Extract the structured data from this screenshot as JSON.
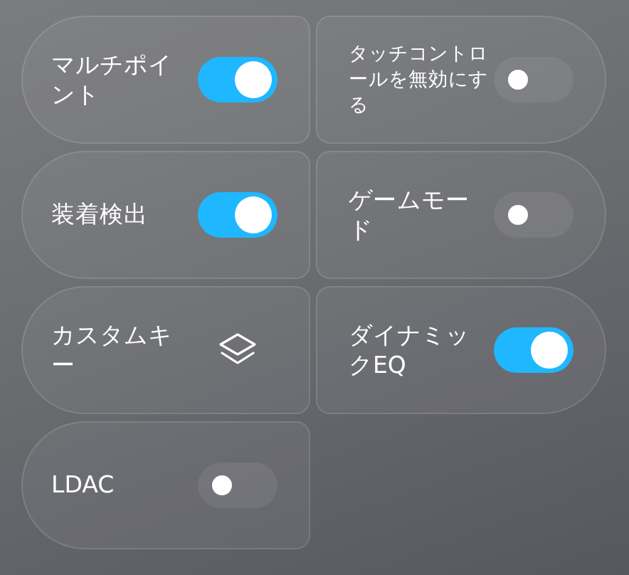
{
  "rows": [
    {
      "tiles": [
        {
          "label": "マルチポイント",
          "kind": "toggle",
          "on": true
        },
        {
          "label": "タッチコントロールを無効にする",
          "kind": "toggle",
          "on": false
        }
      ]
    },
    {
      "tiles": [
        {
          "label": "装着検出",
          "kind": "toggle",
          "on": true
        },
        {
          "label": "ゲームモード",
          "kind": "toggle",
          "on": false
        }
      ]
    },
    {
      "tiles": [
        {
          "label": "カスタムキー",
          "kind": "layers"
        },
        {
          "label": "ダイナミックEQ",
          "kind": "toggle",
          "on": true
        }
      ]
    },
    {
      "tiles": [
        {
          "label": "LDAC",
          "kind": "toggle",
          "on": false
        }
      ]
    }
  ]
}
